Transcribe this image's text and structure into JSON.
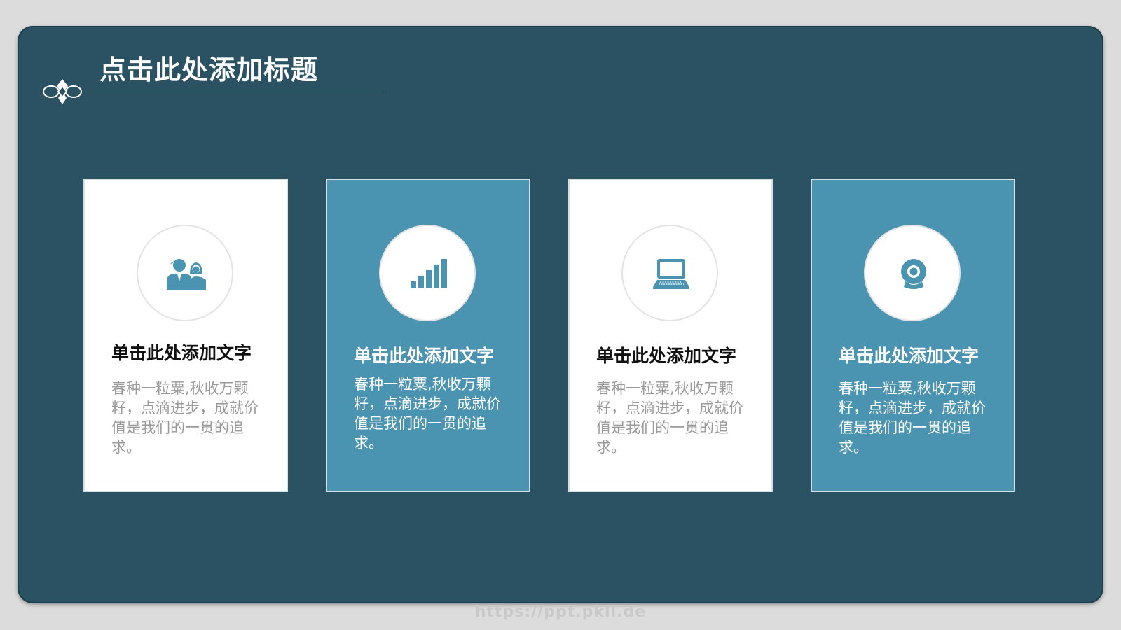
{
  "slide": {
    "title": "点击此处添加标题"
  },
  "cards": [
    {
      "icon": "people-icon",
      "style": "white",
      "heading": "单击此处添加文字",
      "body": "春种一粒粟,秋收万颗籽，点滴进步，成就价值是我们的一贯的追求。"
    },
    {
      "icon": "signal-bars-icon",
      "style": "blue",
      "heading": "单击此处添加文字",
      "body": "春种一粒粟,秋收万颗籽，点滴进步，成就价值是我们的一贯的追求。"
    },
    {
      "icon": "laptop-icon",
      "style": "white",
      "heading": "单击此处添加文字",
      "body": "春种一粒粟,秋收万颗籽，点滴进步，成就价值是我们的一贯的追求。"
    },
    {
      "icon": "webcam-icon",
      "style": "blue",
      "heading": "单击此处添加文字",
      "body": "春种一粒粟,秋收万颗籽，点滴进步，成就价值是我们的一贯的追求。"
    }
  ],
  "watermark": "https://ppt.pkll.de",
  "colors": {
    "background": "#2a5262",
    "card_blue": "#4a93b1",
    "icon": "#4a93b1",
    "frame": "#dcdcdc"
  }
}
